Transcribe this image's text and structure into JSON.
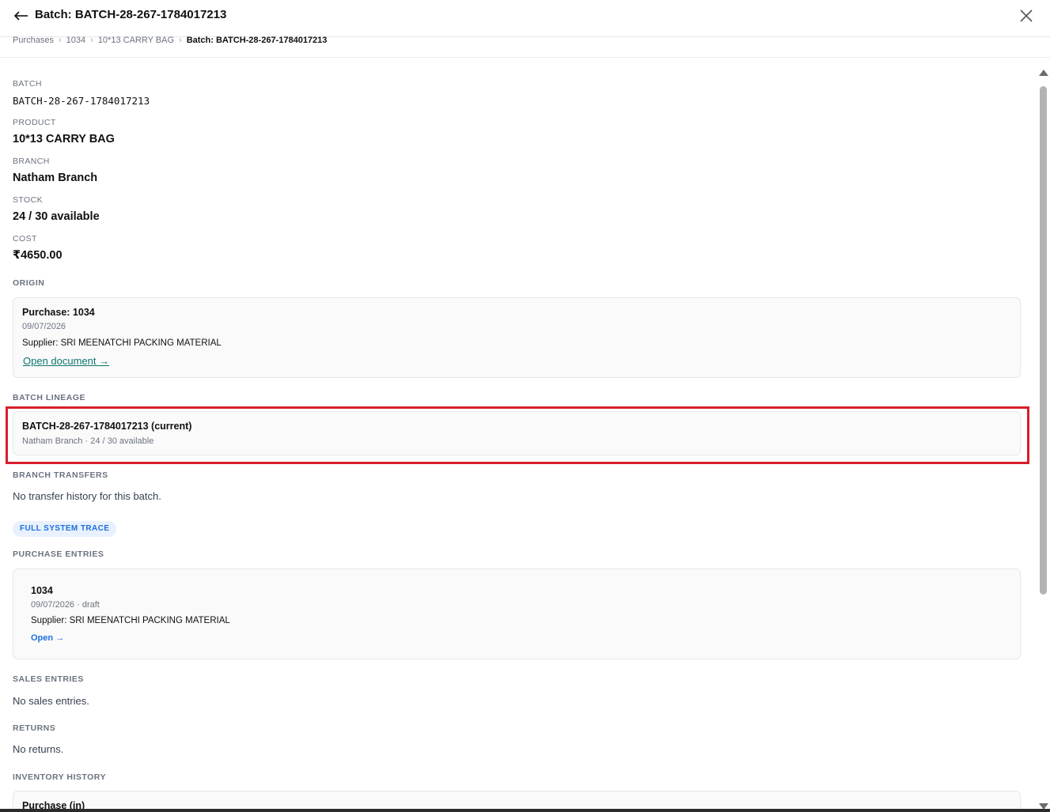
{
  "header": {
    "title": "Batch: BATCH-28-267-1784017213",
    "back_icon": "arrow-left-icon",
    "close_icon": "close-icon"
  },
  "breadcrumb": {
    "items": [
      "Purchases",
      "1034",
      "10*13 CARRY BAG"
    ],
    "current": "Batch: BATCH-28-267-1784017213",
    "separator": "›"
  },
  "details": {
    "batch_label": "BATCH",
    "batch_value": "BATCH-28-267-1784017213",
    "product_label": "PRODUCT",
    "product_value": "10*13 CARRY BAG",
    "branch_label": "BRANCH",
    "branch_value": "Natham Branch",
    "stock_label": "STOCK",
    "stock_value": "24 / 30 available",
    "cost_label": "COST",
    "cost_value": "₹4650.00"
  },
  "origin": {
    "heading": "ORIGIN",
    "title": "Purchase: 1034",
    "date": "09/07/2026",
    "supplier": "Supplier: SRI MEENATCHI PACKING MATERIAL",
    "link": "Open document →"
  },
  "lineage": {
    "heading": "BATCH LINEAGE",
    "title": "BATCH-28-267-1784017213 (current)",
    "sub": "Natham Branch · 24 / 30 available"
  },
  "transfers": {
    "heading": "BRANCH TRANSFERS",
    "empty": "No transfer history for this batch."
  },
  "trace_badge": "FULL SYSTEM TRACE",
  "purchase_entries": {
    "heading": "PURCHASE ENTRIES",
    "title": "1034",
    "sub": "09/07/2026 · draft",
    "supplier": "Supplier: SRI MEENATCHI PACKING MATERIAL",
    "link": "Open →"
  },
  "sales_entries": {
    "heading": "SALES ENTRIES",
    "empty": "No sales entries."
  },
  "returns": {
    "heading": "RETURNS",
    "empty": "No returns."
  },
  "inventory_history": {
    "heading": "INVENTORY HISTORY",
    "first_item": "Purchase (in)"
  },
  "colors": {
    "highlight": "#d91e2b",
    "link_teal": "#0f766e",
    "link_blue": "#1d6fe0",
    "badge_bg": "#e8f1fd"
  }
}
